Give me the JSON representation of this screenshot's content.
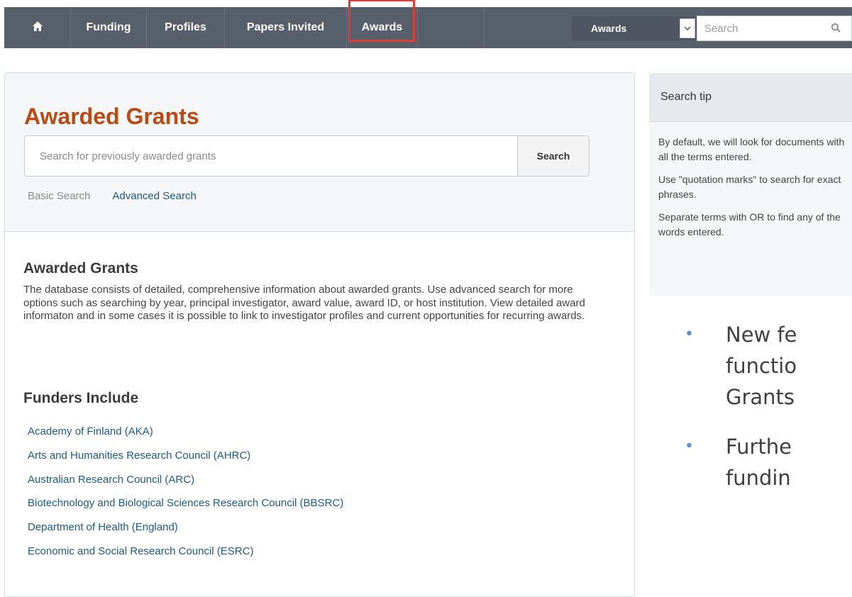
{
  "nav": {
    "items": [
      "Funding",
      "Profiles",
      "Papers Invited",
      "Awards"
    ],
    "home_icon": "home-icon",
    "select_value": "Awards",
    "search_placeholder": "Search",
    "search_icon": "search-icon",
    "highlight_color": "#e03c3c"
  },
  "main": {
    "title": "Awarded Grants",
    "search_placeholder": "Search for previously awarded grants",
    "search_button": "Search",
    "basic_search": "Basic Search",
    "advanced_search": "Advanced Search",
    "section_heading": "Awarded Grants",
    "description": "The database consists of detailed, comprehensive information about awarded grants. Use advanced search for more options such as searching by year, principal investigator, award value, award ID, or host institution. View detailed award informaton and in some cases it is possible to link to investigator profiles and current opportunities for recurring awards.",
    "funders_heading": "Funders Include",
    "funders": [
      "Academy of Finland (AKA)",
      "Arts and Humanities Research Council (AHRC)",
      "Australian Research Council (ARC)",
      "Biotechnology and Biological Sciences Research Council (BBSRC)",
      "Department of Health (England)",
      "Economic and Social Research Council (ESRC)"
    ]
  },
  "tip": {
    "title": "Search tip",
    "lines": [
      "By default, we will look for documents with all the terms entered.",
      "Use \"quotation marks\" to search for exact phrases.",
      "Separate terms with OR to find any of the words entered."
    ]
  },
  "bullets": {
    "items": [
      [
        "New fe",
        "functio",
        "Grants"
      ],
      [
        "Furthe",
        "fundin"
      ]
    ]
  },
  "colors": {
    "nav_bg": "#575f6b",
    "title": "#b84a14",
    "link": "#1e5a8a",
    "bullet": "#5b8fd0"
  }
}
